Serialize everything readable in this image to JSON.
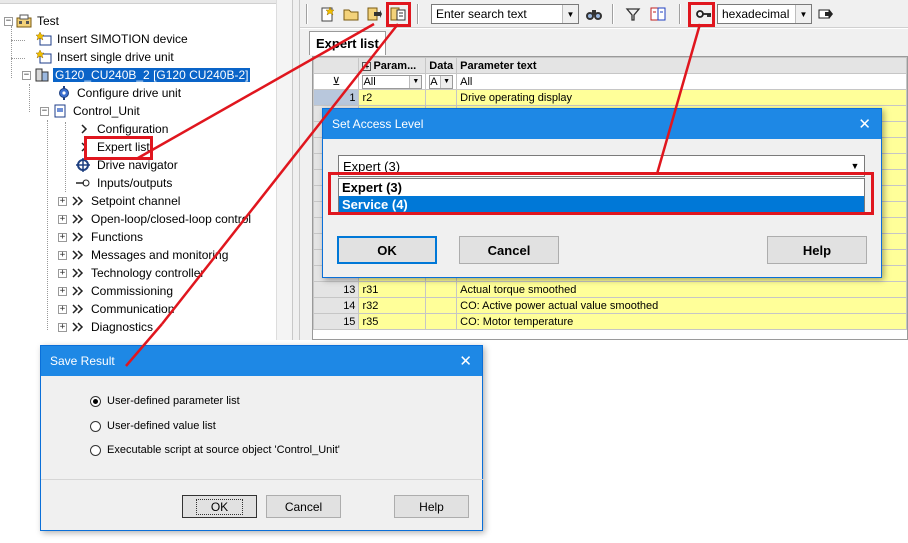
{
  "tree": {
    "root": "Test",
    "items": [
      {
        "label": "Insert SIMOTION device"
      },
      {
        "label": "Insert single drive unit"
      },
      {
        "label": "G120_CU240B_2 [G120 CU240B-2]"
      },
      {
        "label": "Configure drive unit"
      },
      {
        "label": "Control_Unit"
      },
      {
        "label": "Configuration"
      },
      {
        "label": "Expert list"
      },
      {
        "label": "Drive navigator"
      },
      {
        "label": "Inputs/outputs"
      },
      {
        "label": "Setpoint channel"
      },
      {
        "label": "Open-loop/closed-loop control"
      },
      {
        "label": "Functions"
      },
      {
        "label": "Messages and monitoring"
      },
      {
        "label": "Technology controller"
      },
      {
        "label": "Commissioning"
      },
      {
        "label": "Communication"
      },
      {
        "label": "Diagnostics"
      }
    ]
  },
  "toolbar": {
    "search_placeholder": "Enter search text",
    "number_format": "hexadecimal"
  },
  "panel": {
    "tab_label": "Expert list",
    "columns": {
      "param": "Param...",
      "data": "Data",
      "text": "Parameter text"
    },
    "filter": {
      "param": "All",
      "data": "A",
      "text": "All"
    },
    "rows": [
      {
        "n": "1",
        "p": "r2",
        "t": "Drive operating display"
      },
      {
        "n": "",
        "p": "",
        "t": ""
      },
      {
        "n": "",
        "p": "",
        "t": ""
      },
      {
        "n": "",
        "p": "",
        "t": ""
      },
      {
        "n": "",
        "p": "",
        "t": ""
      },
      {
        "n": "",
        "p": "",
        "t": ""
      },
      {
        "n": "",
        "p": "",
        "t": ""
      },
      {
        "n": "",
        "p": "",
        "t": ""
      },
      {
        "n": "",
        "p": "",
        "t": ""
      },
      {
        "n": "",
        "p": "",
        "t": ""
      },
      {
        "n": "",
        "p": "",
        "t": ""
      },
      {
        "n": "",
        "p": "",
        "t": ""
      },
      {
        "n": "13",
        "p": "r31",
        "t": "Actual torque smoothed"
      },
      {
        "n": "14",
        "p": "r32",
        "t": "CO: Active power actual value smoothed"
      },
      {
        "n": "15",
        "p": "r35",
        "t": "CO: Motor temperature"
      }
    ]
  },
  "access_dialog": {
    "title": "Set Access Level",
    "selected": "Expert (3)",
    "options": [
      "Expert (3)",
      "Service (4)"
    ],
    "highlighted_option": "Service (4)",
    "ok": "OK",
    "cancel": "Cancel",
    "help": "Help"
  },
  "save_dialog": {
    "title": "Save Result",
    "options": [
      "User-defined parameter list",
      "User-defined value list",
      "Executable script at source object 'Control_Unit'"
    ],
    "ok": "OK",
    "cancel": "Cancel",
    "help": "Help"
  },
  "colors": {
    "annotation": "#e0161e",
    "title_bar": "#1e88e5",
    "selection": "#0078d7",
    "row_highlight": "#ffff99"
  }
}
